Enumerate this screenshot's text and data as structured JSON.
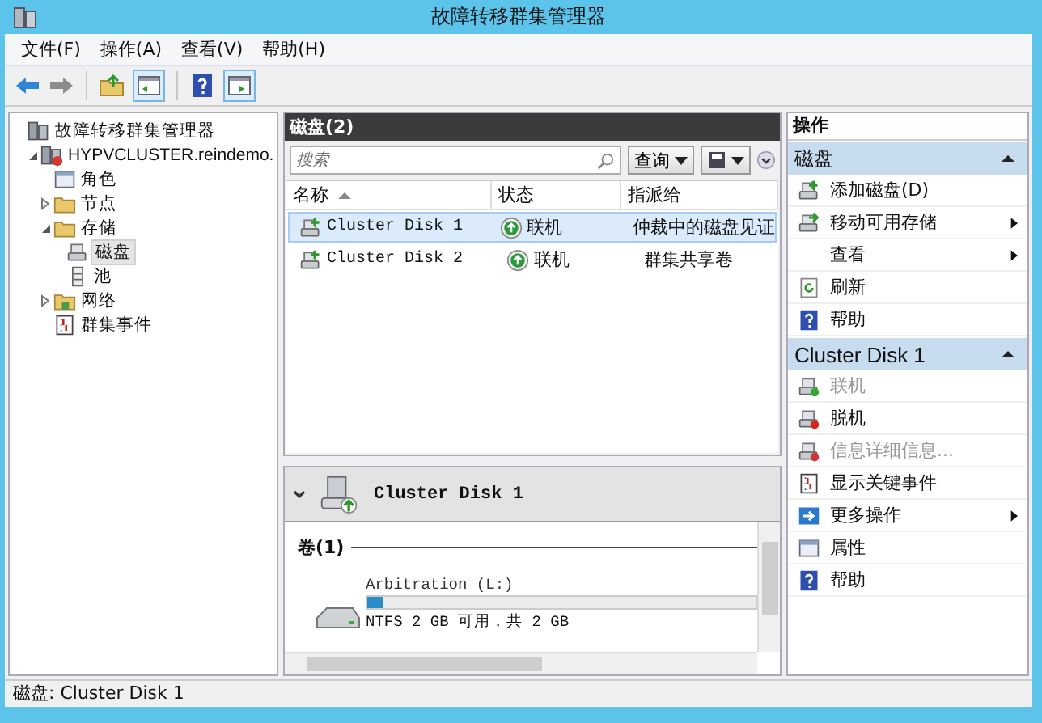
{
  "window": {
    "title": "故障转移群集管理器"
  },
  "menu": [
    "文件(F)",
    "操作(A)",
    "查看(V)",
    "帮助(H)"
  ],
  "tree": [
    {
      "label": "故障转移群集管理器",
      "kind": "manager",
      "selected": false,
      "children": [
        {
          "label": "HYPVCLUSTER.reindemo.",
          "kind": "cluster",
          "selected": false,
          "expanded": true,
          "children": [
            {
              "label": "角色",
              "kind": "roles",
              "selected": false
            },
            {
              "label": "节点",
              "kind": "folder",
              "selected": false,
              "expanded": false
            },
            {
              "label": "存储",
              "kind": "folder",
              "selected": false,
              "expanded": true,
              "children": [
                {
                  "label": "磁盘",
                  "kind": "disk",
                  "selected": true
                },
                {
                  "label": "池",
                  "kind": "pool",
                  "selected": false
                }
              ]
            },
            {
              "label": "网络",
              "kind": "network",
              "selected": false,
              "expanded": false
            },
            {
              "label": "群集事件",
              "kind": "events",
              "selected": false
            }
          ]
        }
      ]
    }
  ],
  "disks": {
    "title": "磁盘(2)",
    "search": {
      "placeholder": "搜索"
    },
    "query": "查询",
    "columns": [
      {
        "label": "名称",
        "sorted": true
      },
      {
        "label": "状态",
        "sorted": false
      },
      {
        "label": "指派给",
        "sorted": false
      }
    ],
    "rows": [
      {
        "name": "Cluster Disk 1",
        "status": "联机",
        "assigned": "仲裁中的磁盘见证",
        "selected": true
      },
      {
        "name": "Cluster Disk 2",
        "status": "联机",
        "assigned": "群集共享卷",
        "selected": false
      }
    ]
  },
  "detail": {
    "title": "Cluster Disk 1",
    "volumes_heading": "卷(1)",
    "volumes": [
      {
        "label": "Arbitration (L:)",
        "level": 0.04,
        "summary": "NTFS 2 GB 可用，共 2 GB"
      }
    ]
  },
  "actions": {
    "title": "操作",
    "groups": [
      {
        "title": "磁盘",
        "items": [
          {
            "label": "添加磁盘(D)",
            "kind": "add-disk",
            "submenu": false,
            "disabled": false
          },
          {
            "label": "移动可用存储",
            "kind": "move-disk",
            "submenu": true,
            "disabled": false
          },
          {
            "label": "查看",
            "kind": "none",
            "submenu": true,
            "disabled": false
          },
          {
            "label": "刷新",
            "kind": "refresh",
            "submenu": false,
            "disabled": false
          },
          {
            "label": "帮助",
            "kind": "help",
            "submenu": false,
            "disabled": false
          }
        ]
      },
      {
        "title": "Cluster Disk 1",
        "items": [
          {
            "label": "联机",
            "kind": "online",
            "submenu": false,
            "disabled": true
          },
          {
            "label": "脱机",
            "kind": "offline",
            "submenu": false,
            "disabled": false
          },
          {
            "label": "信息详细信息...",
            "kind": "info",
            "submenu": false,
            "disabled": true
          },
          {
            "label": "显示关键事件",
            "kind": "events",
            "submenu": false,
            "disabled": false
          },
          {
            "label": "更多操作",
            "kind": "more",
            "submenu": true,
            "disabled": false
          },
          {
            "label": "属性",
            "kind": "properties",
            "submenu": false,
            "disabled": false
          },
          {
            "label": "帮助",
            "kind": "help",
            "submenu": false,
            "disabled": false
          }
        ]
      }
    ]
  },
  "status_bar": "磁盘: Cluster Disk 1"
}
